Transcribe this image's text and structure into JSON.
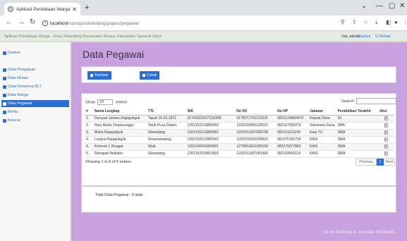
{
  "browser": {
    "tab_title": "Aplikasi Pendataan Warga",
    "url_host": "localhost",
    "url_path": "/xampp/sibandang/pages/pegawai/"
  },
  "app": {
    "title": "Aplikasi Pendataan Warga - Desa Sibandang Kecamatan Muara, Kabupaten Tapanuli Utara",
    "user": "Hai, admin",
    "dashboard_link": "Dasbor",
    "logout_link": "Keluar"
  },
  "sidebar": {
    "items": [
      {
        "label": "Dasbor"
      },
      {
        "label": "Data Pengajuan"
      },
      {
        "label": "Data Mutasi"
      },
      {
        "label": "Data Penerima BLT"
      },
      {
        "label": "Data Warga"
      },
      {
        "label": "Data Pegawai"
      },
      {
        "label": "Berita"
      },
      {
        "label": "Kelurar"
      }
    ]
  },
  "main": {
    "title": "Data Pegawai",
    "add_button": "Tambah",
    "print_button": "Cetak",
    "show_label": "Show",
    "entries_value": "10",
    "entries_label": "entries",
    "search_label": "Search:",
    "columns": [
      "#",
      "Nama Lengkap",
      "TTL",
      "NIK",
      "No KK",
      "No HP",
      "Jabatan",
      "Pendidikan Terakhir",
      "Aksi"
    ],
    "rows": [
      [
        "1.",
        "Hursyan Jamaru Rajagukguk",
        "Tapuk 15-01-1971",
        "3175031501711500I5",
        "3175071702121025",
        "082212986l4479",
        "Kepala Desa",
        "S1"
      ],
      [
        "2.",
        "Hary Aluba Ompusunggu",
        "Teluk Pusa Dalam,",
        "1202152216880002",
        "1202150999120015",
        "082167909379",
        "Sekretaris Desa",
        "SMK"
      ],
      [
        "3.",
        "Maria Rajagukguk",
        "Sibandang,",
        "1202155212800091",
        "1202151607082158",
        "082151101194",
        "Kaur TU",
        "SMA"
      ],
      [
        "4.",
        "Lenguo Rajagukguk",
        "Simanampang,",
        "1202152412880001",
        "1202150203100003",
        "081375182754",
        "KASI",
        "SMA"
      ],
      [
        "5.",
        "Krismon L Sinagar",
        "Silali,",
        "1202150601890001",
        "1275061810180159",
        "082276077883",
        "KASI",
        "SMA"
      ],
      [
        "6.",
        "Ranapati Naibaho",
        "Sibandang,",
        "1202152910810002",
        "1202151007081969",
        "082164669119",
        "KASI",
        "SMA"
      ]
    ],
    "info": "Showing 1 to 6 of 6 entries",
    "prev": "Previous",
    "page": "1",
    "next": "Next",
    "total": "Total Data Pegawai : 6 data"
  },
  "watermark": "Go to Settings to activate Windows."
}
